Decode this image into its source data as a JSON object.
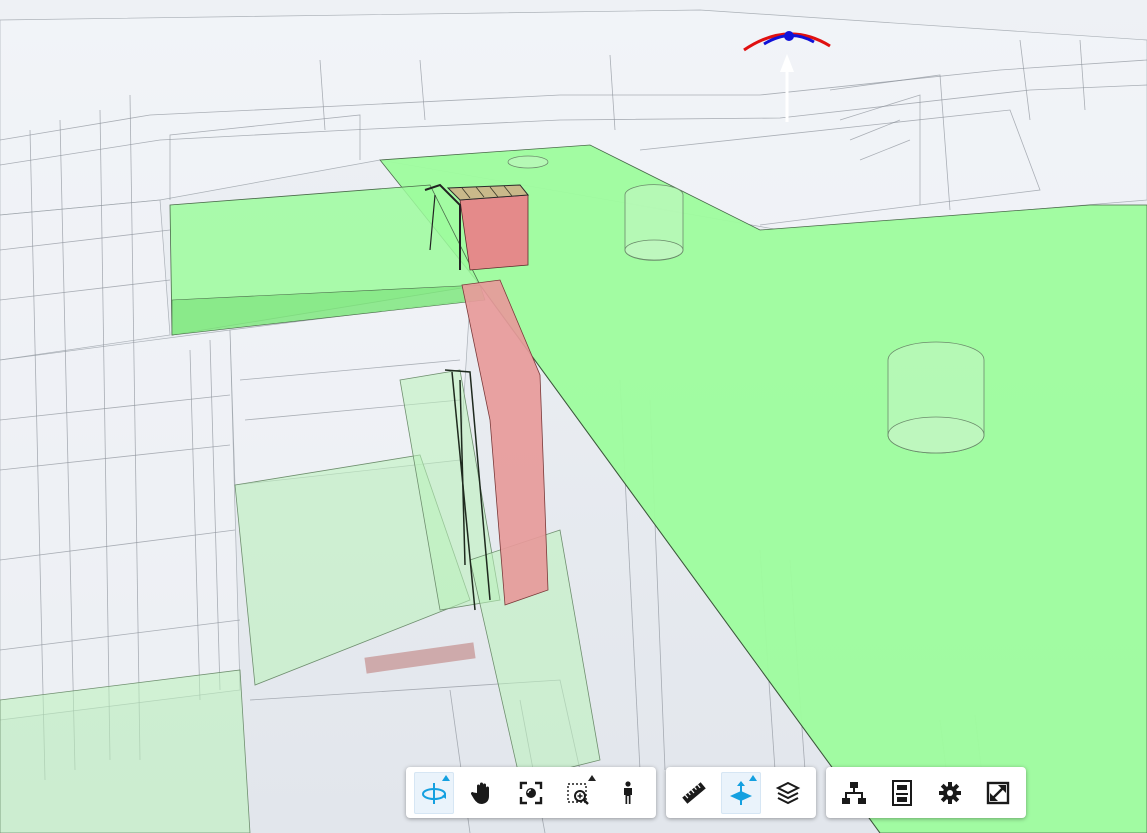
{
  "viewer": {
    "colors": {
      "background": "#dfe3ea",
      "floor": "#9efc9e",
      "column": "#e48a8a",
      "active_tool": "#14a0e0",
      "gizmo_red": "#e01010",
      "gizmo_blue": "#1010d8"
    }
  },
  "toolbar": {
    "navigation": [
      {
        "name": "orbit-button",
        "icon": "orbit-icon",
        "active": true,
        "flyout": true
      },
      {
        "name": "pan-button",
        "icon": "hand-icon",
        "active": false,
        "flyout": false
      },
      {
        "name": "fit-to-view-button",
        "icon": "fit-view-icon",
        "active": false,
        "flyout": false
      },
      {
        "name": "zoom-window-button",
        "icon": "zoom-window-icon",
        "active": false,
        "flyout": true
      },
      {
        "name": "first-person-button",
        "icon": "person-icon",
        "active": false,
        "flyout": false
      }
    ],
    "analysis": [
      {
        "name": "measure-button",
        "icon": "ruler-icon",
        "active": false,
        "flyout": false
      },
      {
        "name": "section-button",
        "icon": "section-plane-icon",
        "active": true,
        "flyout": true
      },
      {
        "name": "explode-button",
        "icon": "layers-icon",
        "active": false,
        "flyout": false
      }
    ],
    "settings": [
      {
        "name": "model-browser-button",
        "icon": "tree-icon",
        "active": false,
        "flyout": false
      },
      {
        "name": "properties-button",
        "icon": "properties-icon",
        "active": false,
        "flyout": false
      },
      {
        "name": "settings-button",
        "icon": "gear-icon",
        "active": false,
        "flyout": false
      },
      {
        "name": "fullscreen-button",
        "icon": "fullscreen-icon",
        "active": false,
        "flyout": false
      }
    ]
  }
}
